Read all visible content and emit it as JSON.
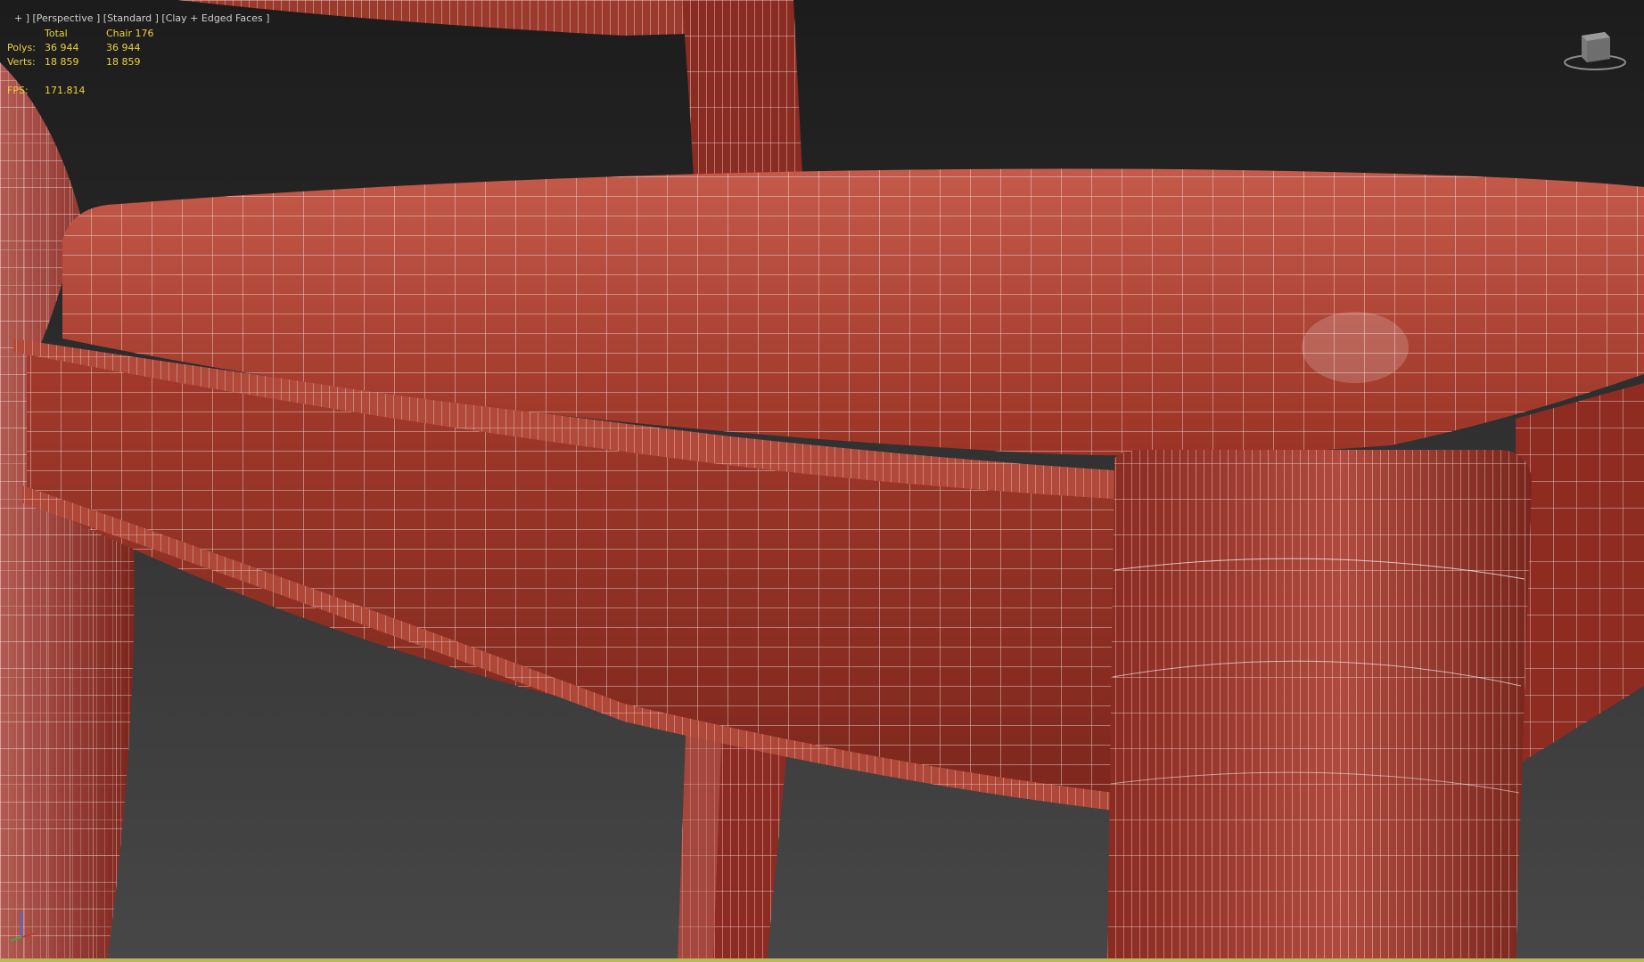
{
  "viewport": {
    "label_parts": [
      "+",
      "[Perspective]",
      "[Standard]",
      "[Clay + Edged Faces]"
    ],
    "label_text": "+ ] [Perspective ] [Standard ] [Clay + Edged Faces ]"
  },
  "stats": {
    "header": {
      "col1": "",
      "col2": "Total",
      "col3": "Chair 176"
    },
    "polys": {
      "label": "Polys:",
      "total": "36 944",
      "selected": "36 944"
    },
    "verts": {
      "label": "Verts:",
      "total": "18 859",
      "selected": "18 859"
    },
    "fps": {
      "label": "FPS:",
      "value": "171.814"
    }
  },
  "colors": {
    "background_top": "#1c1c1c",
    "background_bottom": "#474747",
    "mesh_clay": "#a8392c",
    "wire": "#ffffff",
    "stats_text": "#e8d23c",
    "label_text": "#cfcfcf"
  },
  "icons": {
    "viewcube": "viewcube-icon",
    "axis": "axis-tripod-icon"
  }
}
